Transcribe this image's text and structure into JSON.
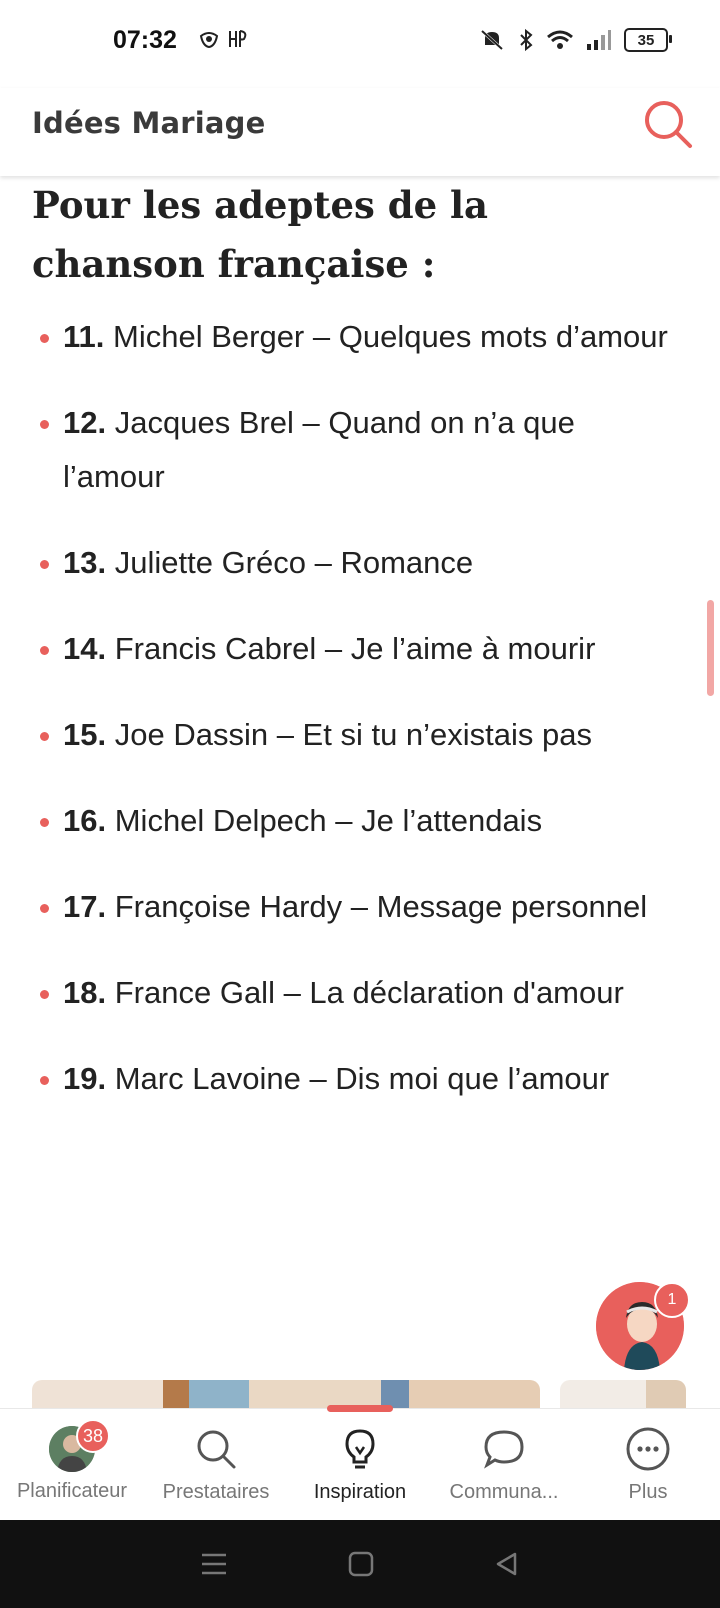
{
  "status_bar": {
    "time": "07:32",
    "battery": "35"
  },
  "header": {
    "title": "Idées Mariage",
    "search_icon": "search-icon"
  },
  "article": {
    "heading": "Pour les adeptes de la chanson française :",
    "songs": [
      {
        "num": "11.",
        "text": "Michel Berger – Quelques mots d’amour"
      },
      {
        "num": "12.",
        "text": "Jacques Brel – Quand on n’a que l’amour"
      },
      {
        "num": "13.",
        "text": "Juliette Gréco – Romance"
      },
      {
        "num": "14.",
        "text": "Francis Cabrel – Je l’aime à mourir"
      },
      {
        "num": "15.",
        "text": "Joe Dassin – Et si tu n’existais pas"
      },
      {
        "num": "16.",
        "text": "Michel Delpech – Je l’attendais"
      },
      {
        "num": "17.",
        "text": "Françoise Hardy – Message personnel"
      },
      {
        "num": "18.",
        "text": "France Gall – La déclaration d'amour"
      },
      {
        "num": "19.",
        "text": "Marc Lavoine – Dis moi que l’amour"
      }
    ]
  },
  "assistant": {
    "badge": "1"
  },
  "bottom_nav": {
    "items": [
      {
        "label": "Planificateur",
        "badge": "38"
      },
      {
        "label": "Prestataires"
      },
      {
        "label": "Inspiration"
      },
      {
        "label": "Communa..."
      },
      {
        "label": "Plus"
      }
    ]
  },
  "colors": {
    "accent": "#e8605c",
    "text": "#222222"
  }
}
